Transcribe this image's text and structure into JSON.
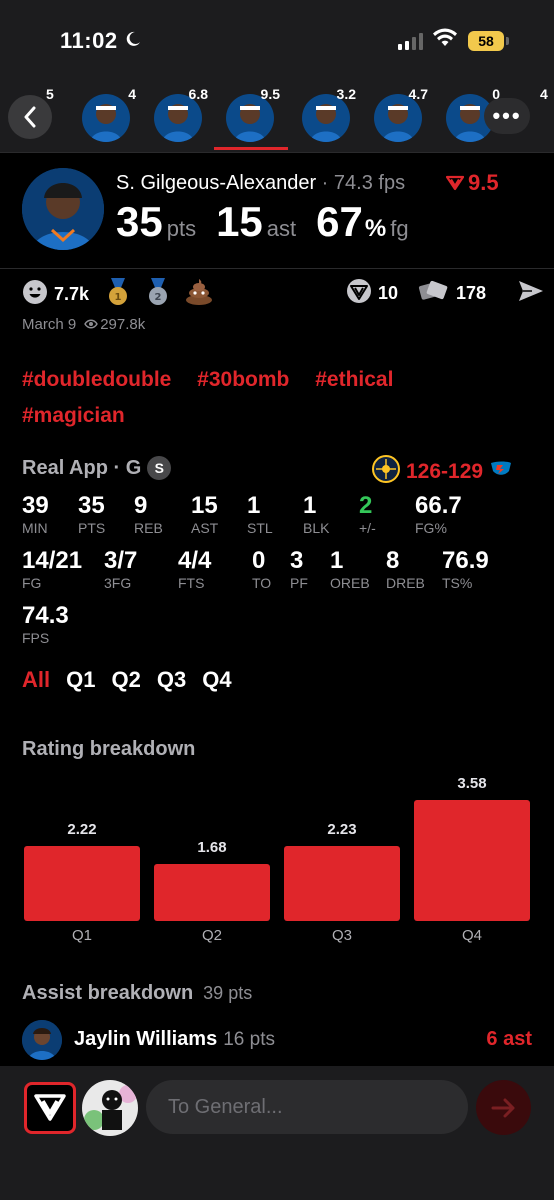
{
  "status": {
    "time": "11:02",
    "battery": "58"
  },
  "strip": {
    "values": [
      "5",
      "4",
      "6.8",
      "9.5",
      "3.2",
      "4.7",
      "0",
      "4"
    ]
  },
  "player": {
    "name": "S. Gilgeous-Alexander",
    "separator": "·",
    "fps": "74.3 fps",
    "rating": "9.5",
    "points": "35",
    "points_unit": "pts",
    "assists": "15",
    "assists_unit": "ast",
    "fg_pct": "67",
    "fg_pct_sign": "%",
    "fg_pct_unit": "fg"
  },
  "reactions": {
    "likes": "7.7k",
    "takes": "10",
    "cards": "178",
    "date": "March 9",
    "views": "297.8k"
  },
  "tags": [
    "#doubledouble",
    "#30bomb",
    "#ethical",
    "#magician"
  ],
  "game": {
    "title": "Real App · G",
    "badge": "S",
    "score_away": "126",
    "score_dash": "-",
    "score_home": "129"
  },
  "stats": [
    {
      "value": "39",
      "label": "MIN"
    },
    {
      "value": "35",
      "label": "PTS"
    },
    {
      "value": "9",
      "label": "REB"
    },
    {
      "value": "15",
      "label": "AST"
    },
    {
      "value": "1",
      "label": "STL"
    },
    {
      "value": "1",
      "label": "BLK"
    },
    {
      "value": "2",
      "label": "+/-"
    },
    {
      "value": "66.7",
      "label": "FG%"
    },
    {
      "value": "14/21",
      "label": "FG"
    },
    {
      "value": "3/7",
      "label": "3FG"
    },
    {
      "value": "4/4",
      "label": "FTS"
    },
    {
      "value": "0",
      "label": "TO"
    },
    {
      "value": "3",
      "label": "PF"
    },
    {
      "value": "1",
      "label": "OREB"
    },
    {
      "value": "8",
      "label": "DREB"
    },
    {
      "value": "76.9",
      "label": "TS%"
    },
    {
      "value": "74.3",
      "label": "FPS"
    }
  ],
  "colors": {
    "accent": "#e0262b",
    "positive": "#34c759",
    "background": "#000000",
    "panel": "#1c1c1e"
  },
  "quarter_tabs": [
    "All",
    "Q1",
    "Q2",
    "Q3",
    "Q4"
  ],
  "rating_breakdown": {
    "title": "Rating breakdown"
  },
  "chart_data": {
    "type": "bar",
    "categories": [
      "Q1",
      "Q2",
      "Q3",
      "Q4"
    ],
    "values": [
      2.22,
      1.68,
      2.23,
      3.58
    ]
  },
  "assist": {
    "title": "Assist breakdown",
    "subtitle": "39 pts",
    "rows": [
      {
        "name": "Jaylin Williams",
        "pts": "16 pts",
        "ast": "6 ast"
      }
    ]
  },
  "composer": {
    "placeholder": "To General..."
  }
}
